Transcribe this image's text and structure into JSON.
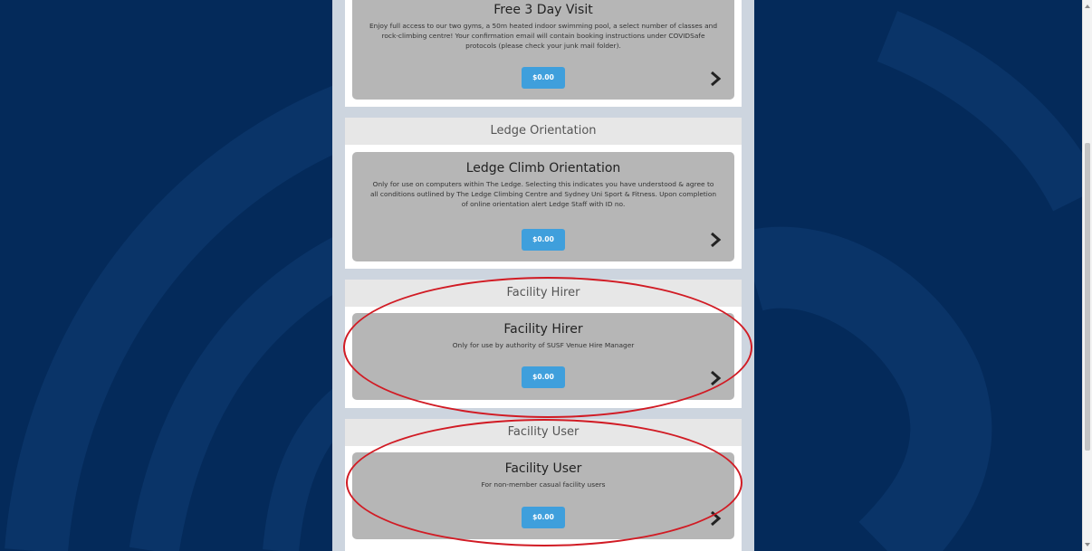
{
  "sections": [
    {
      "header": "",
      "card": {
        "title": "Free 3 Day Visit",
        "description": "Enjoy full access to our two gyms, a 50m heated indoor swimming pool, a select number of classes and rock-climbing centre! Your confirmation email will contain booking instructions under COVIDSafe protocols (please check your junk mail folder).",
        "price": "$0.00"
      }
    },
    {
      "header": "Ledge Orientation",
      "card": {
        "title": "Ledge Climb Orientation",
        "description": "Only for use on computers within The Ledge. Selecting this indicates you have understood & agree to all conditions outlined by The Ledge Climbing Centre and Sydney Uni Sport & Fitness. Upon completion of online orientation alert Ledge Staff with ID no.",
        "price": "$0.00"
      }
    },
    {
      "header": "Facility Hirer",
      "card": {
        "title": "Facility Hirer",
        "description": "Only for use by authority of SUSF Venue Hire Manager",
        "price": "$0.00"
      }
    },
    {
      "header": "Facility User",
      "card": {
        "title": "Facility User",
        "description": "For non-member casual facility users",
        "price": "$0.00"
      }
    }
  ],
  "colors": {
    "background": "#042a5a",
    "column": "#cdd5df",
    "card": "#b6b6b6",
    "price_button": "#3f9fdc",
    "annotation_oval": "#d11b24"
  },
  "icons": {
    "chevron": "chevron-right-icon"
  }
}
